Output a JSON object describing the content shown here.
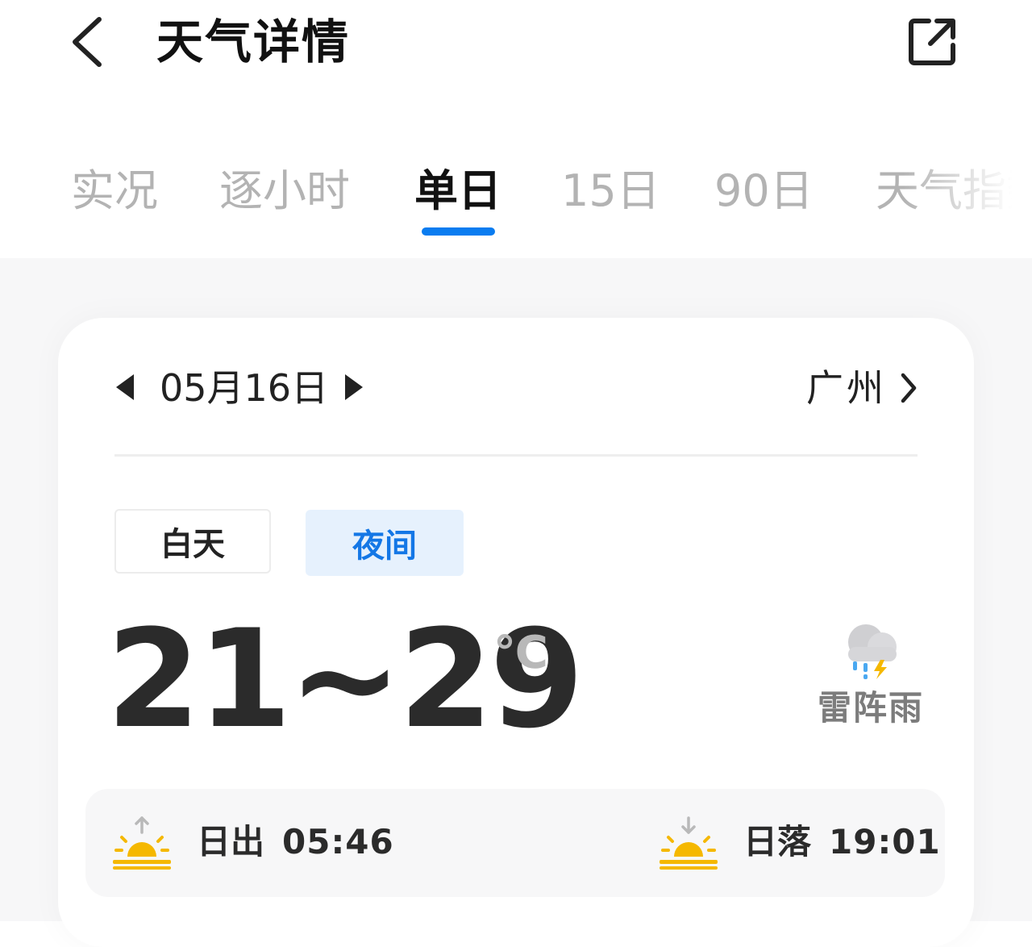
{
  "header": {
    "title": "天气详情",
    "back_icon": "chevron-left-icon",
    "share_icon": "external-link-icon"
  },
  "tabs": [
    {
      "label": "实况",
      "active": false
    },
    {
      "label": "逐小时",
      "active": false
    },
    {
      "label": "单日",
      "active": true
    },
    {
      "label": "15日",
      "active": false
    },
    {
      "label": "90日",
      "active": false
    },
    {
      "label": "天气指数",
      "active": false
    }
  ],
  "day_card": {
    "date": "05月16日",
    "city": "广州",
    "segments": {
      "day": "白天",
      "night": "夜间",
      "selected": "night"
    },
    "temperature": "21~29",
    "unit": "℃",
    "condition": "雷阵雨",
    "condition_icon": "thunder-shower-icon",
    "sunrise": {
      "label": "日出",
      "time": "05:46"
    },
    "sunset": {
      "label": "日落",
      "time": "19:01"
    }
  },
  "colors": {
    "accent": "#0a7cf0",
    "selected_segment_bg": "#e6f1fd",
    "selected_segment_text": "#1477e6",
    "inactive_tab": "#b3b3b3",
    "sun": "#f5b800"
  }
}
